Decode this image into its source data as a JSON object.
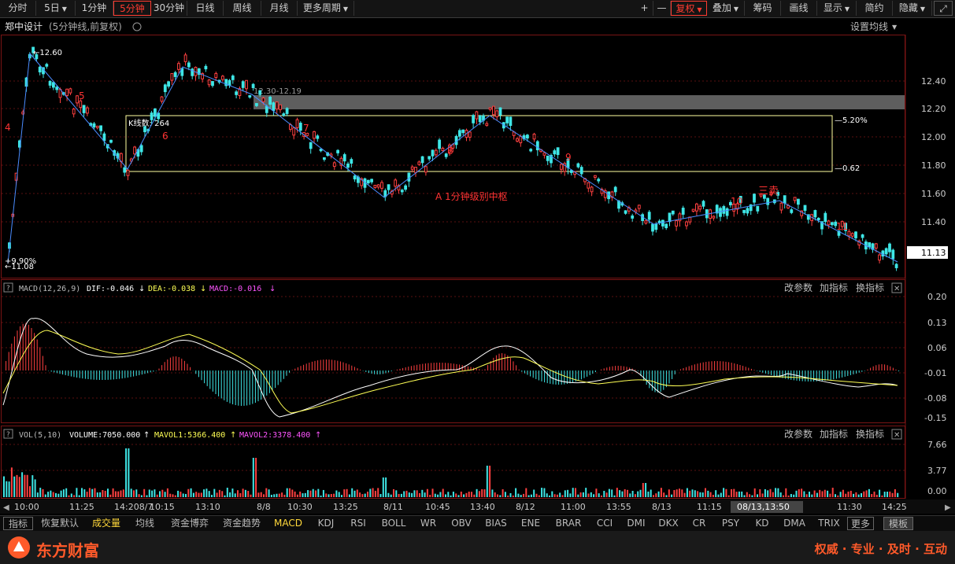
{
  "toolbar": {
    "periods": [
      "分时",
      "5日",
      "1分钟",
      "5分钟",
      "30分钟",
      "日线",
      "周线",
      "月线",
      "更多周期"
    ],
    "active_period": "5分钟",
    "right": [
      "+",
      "—",
      "复权",
      "叠加",
      "筹码",
      "画线",
      "显示",
      "简约",
      "隐藏"
    ]
  },
  "header": {
    "stock_name": "郑中设计",
    "sub": "(5分钟线,前复权)",
    "ma_setting": "设置均线"
  },
  "price_axis": {
    "labels": [
      "12.40",
      "12.20",
      "12.00",
      "11.80",
      "11.60",
      "11.40",
      "11.13"
    ],
    "current": "11.13"
  },
  "annotations": {
    "high_label": "12.60",
    "low_label": "11.08",
    "pct_label": "9.90%",
    "box_range": "12.30-12.19",
    "kline_count": "K线数: 264",
    "box_pct": "5.20%",
    "box_pct2": "0.62",
    "zhongshu": "A  1分钟级别中枢",
    "sanmai": "三卖",
    "wave_numbers": [
      "4",
      "5",
      "6",
      "7",
      "8",
      "9",
      "10",
      "11"
    ]
  },
  "macd": {
    "title": "MACD(12,26,9)",
    "dif": "DIF:-0.046",
    "dea": "DEA:-0.038",
    "macd": "MACD:-0.016",
    "axis": [
      "0.20",
      "0.13",
      "0.06",
      "-0.01",
      "-0.08",
      "-0.15"
    ],
    "buttons": [
      "改参数",
      "加指标",
      "换指标"
    ]
  },
  "vol": {
    "title": "VOL(5,10)",
    "volume": "VOLUME:7050.000",
    "mavol1": "MAVOL1:5366.400",
    "mavol2": "MAVOL2:3378.400",
    "axis": [
      "7.66",
      "3.77",
      "0.00"
    ],
    "buttons": [
      "改参数",
      "加指标",
      "换指标"
    ]
  },
  "time_axis": {
    "labels": [
      "10:00",
      "11:25",
      "14:208/7",
      "10:15",
      "13:10",
      "8/8",
      "10:30",
      "13:25",
      "8/11",
      "10:45",
      "13:40",
      "8/12",
      "11:00",
      "13:55",
      "8/13",
      "11:15",
      "11:30",
      "14:25"
    ],
    "cursor": "08/13,13:50"
  },
  "indicators": [
    "指标",
    "恢复默认",
    "成交量",
    "均线",
    "资金博弈",
    "资金趋势",
    "MACD",
    "KDJ",
    "RSI",
    "BOLL",
    "WR",
    "OBV",
    "BIAS",
    "ENE",
    "BRAR",
    "CCI",
    "DMI",
    "DKX",
    "CR",
    "PSY",
    "KD",
    "DMA",
    "TRIX",
    "更多",
    "模板"
  ],
  "footer": {
    "brand": "东方财富",
    "slogan": "权威 · 专业 · 及时 · 互动"
  },
  "colors": {
    "up": "#ff4040",
    "down": "#3ee6e6",
    "line_dif": "#ffffff",
    "line_dea": "#ffff55",
    "pen": "#4a8cff",
    "box": "#ffffa0"
  }
}
